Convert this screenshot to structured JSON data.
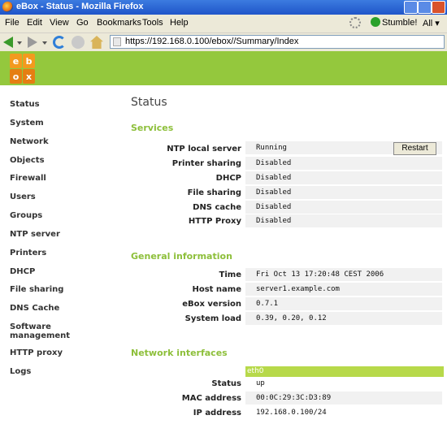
{
  "window": {
    "title": "eBox - Status - Mozilla Firefox"
  },
  "menubar": {
    "items": [
      "File",
      "Edit",
      "View",
      "Go",
      "Bookmarks",
      "Tools",
      "Help"
    ],
    "stumble_label": "Stumble!",
    "all_label": "All"
  },
  "navbar": {
    "url": "https://192.168.0.100/ebox//Summary/Index"
  },
  "sidebar": {
    "items": [
      "Status",
      "System",
      "Network",
      "Objects",
      "Firewall",
      "Users",
      "Groups",
      "NTP server",
      "Printers",
      "DHCP",
      "File sharing",
      "DNS Cache",
      "Software management",
      "HTTP proxy",
      "Logs"
    ]
  },
  "main": {
    "title": "Status",
    "services": {
      "heading": "Services",
      "rows": [
        {
          "label": "NTP local server",
          "value": "Running"
        },
        {
          "label": "Printer sharing",
          "value": "Disabled"
        },
        {
          "label": "DHCP",
          "value": "Disabled"
        },
        {
          "label": "File sharing",
          "value": "Disabled"
        },
        {
          "label": "DNS cache",
          "value": "Disabled"
        },
        {
          "label": "HTTP Proxy",
          "value": "Disabled"
        }
      ],
      "restart_label": "Restart"
    },
    "general": {
      "heading": "General information",
      "rows": [
        {
          "label": "Time",
          "value": "Fri Oct 13 17:20:48 CEST 2006"
        },
        {
          "label": "Host name",
          "value": "server1.example.com"
        },
        {
          "label": "eBox version",
          "value": "0.7.1"
        },
        {
          "label": "System load",
          "value": "0.39, 0.20, 0.12"
        }
      ]
    },
    "network": {
      "heading": "Network interfaces",
      "interface": "eth0",
      "rows": [
        {
          "label": "Status",
          "value": "up"
        },
        {
          "label": "MAC address",
          "value": "00:0C:29:3C:D3:89"
        },
        {
          "label": "IP address",
          "value": "192.168.0.100/24"
        }
      ]
    }
  },
  "colors": {
    "accent": "#94c83d",
    "section_heading": "#8dbf3a",
    "logo_orange": "#f39a1e"
  }
}
